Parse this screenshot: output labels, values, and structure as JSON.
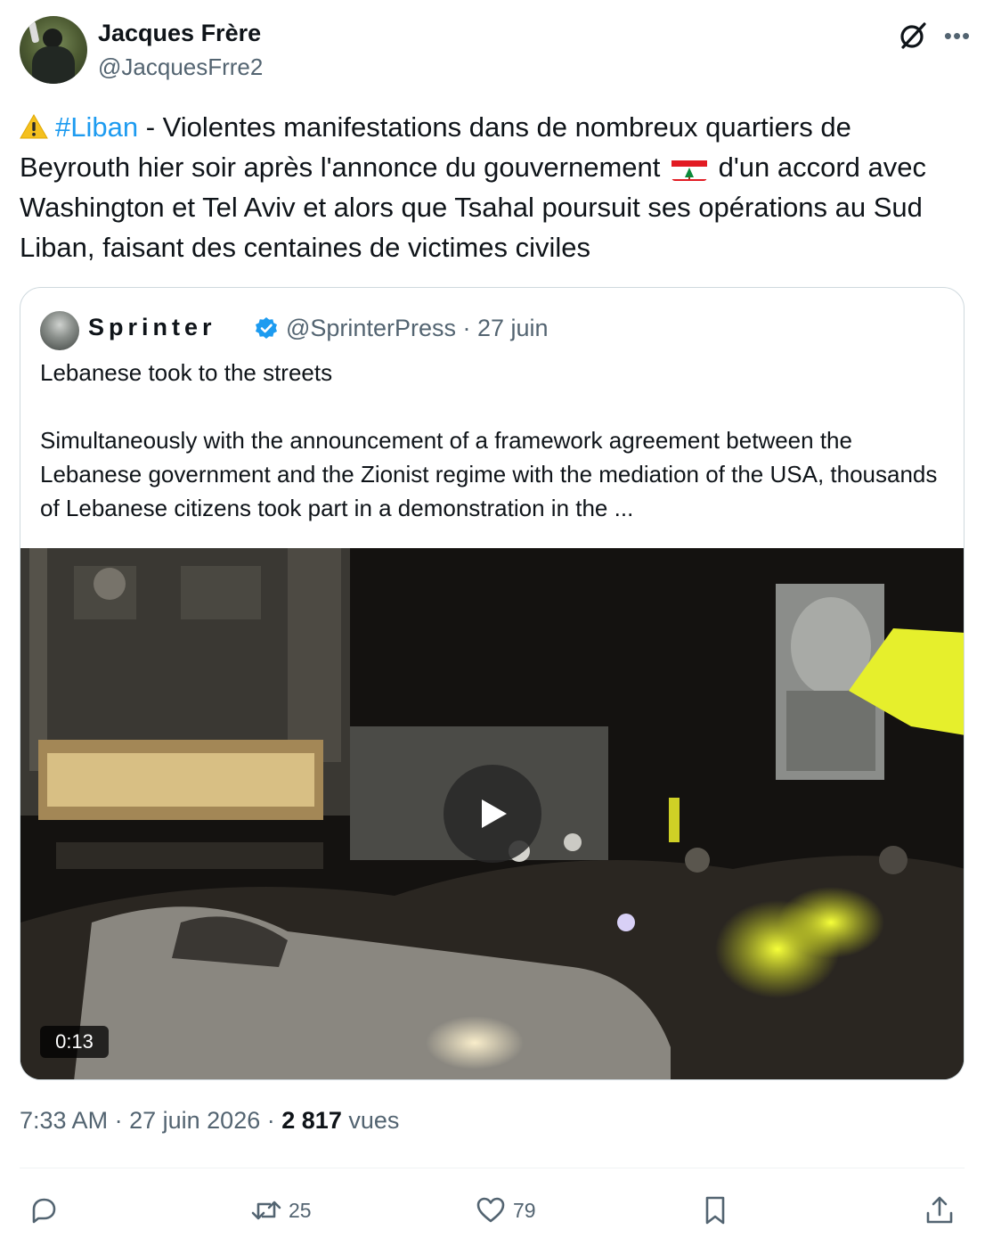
{
  "author": {
    "display_name": "Jacques Frère",
    "handle": "@JacquesFrre2"
  },
  "tweet": {
    "warning_icon": "warning-emoji",
    "hashtag": "#Liban",
    "text_part1": " - Violentes manifestations dans de nombreux quartiers de Beyrouth hier soir après l'annonce du gouvernement ",
    "flag_icon": "lebanon-flag-emoji",
    "text_part2": " d'un accord avec Washington et Tel Aviv et alors que Tsahal poursuit ses opérations au Sud Liban, faisant des centaines de victimes civiles"
  },
  "quote": {
    "display_name": "Sprinter",
    "verified": true,
    "handle": "@SprinterPress",
    "separator": "·",
    "date": "27 juin",
    "line1": "Lebanese took to the streets",
    "line2": "Simultaneously with the announcement of a framework agreement between the Lebanese government and the Zionist regime with the mediation of the USA, thousands of Lebanese citizens took part in a demonstration in the ...",
    "video": {
      "duration": "0:13"
    }
  },
  "meta": {
    "time": "7:33 AM",
    "sep1": "·",
    "date": "27 juin 2026",
    "sep2": "·",
    "views_count": "2 817",
    "views_label": "vues"
  },
  "actions": {
    "reply_count": "",
    "retweet_count": "25",
    "like_count": "79"
  },
  "colors": {
    "accent": "#1d9bf0",
    "text": "#0f1419",
    "muted": "#536471",
    "border": "#cfd9de"
  }
}
